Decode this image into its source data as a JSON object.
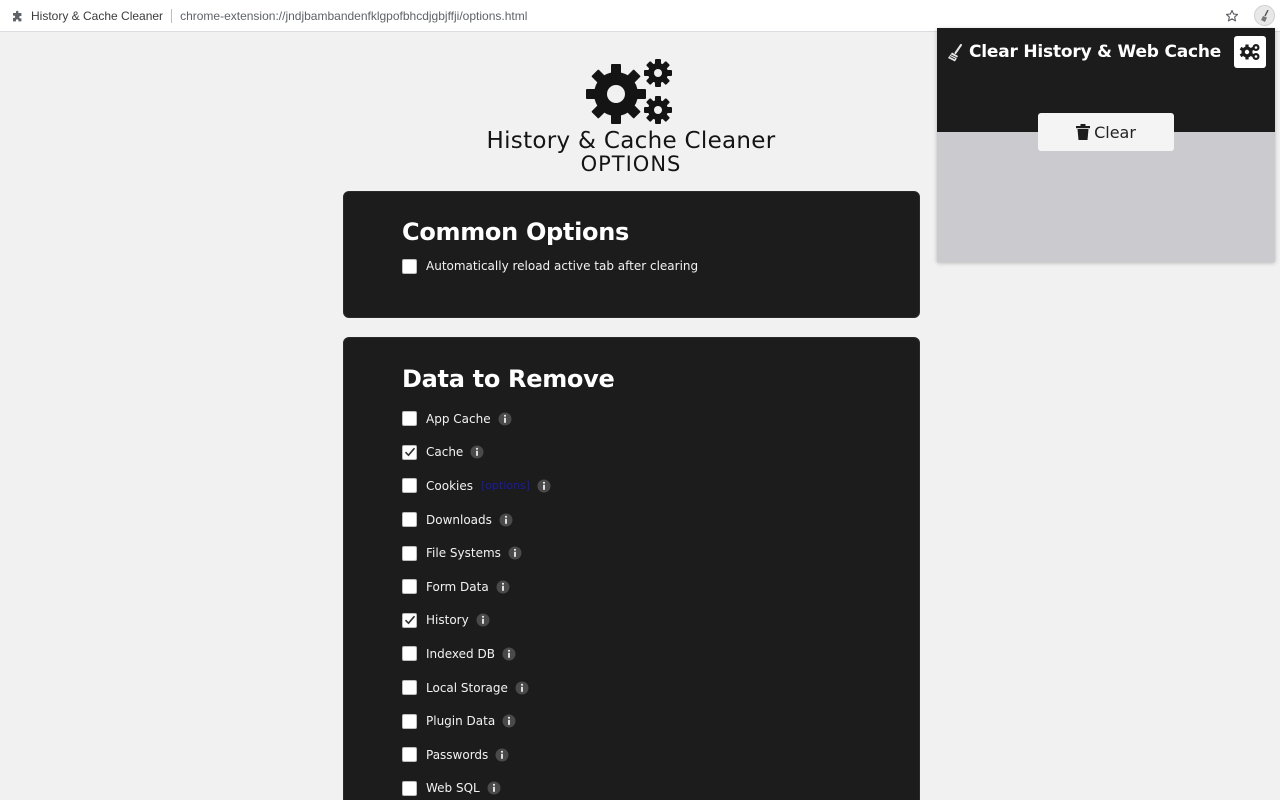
{
  "browser": {
    "tab_title": "History & Cache Cleaner",
    "url": "chrome-extension://jndjbambandenfklgpofbhcdjgbjffji/options.html"
  },
  "header": {
    "title": "History & Cache Cleaner",
    "subtitle": "OPTIONS"
  },
  "common_options": {
    "heading": "Common Options",
    "items": [
      {
        "label": "Automatically reload active tab after clearing",
        "checked": false
      }
    ]
  },
  "data_to_remove": {
    "heading": "Data to Remove",
    "items": [
      {
        "label": "App Cache",
        "checked": false
      },
      {
        "label": "Cache",
        "checked": true
      },
      {
        "label": "Cookies",
        "checked": false,
        "link": "[options]"
      },
      {
        "label": "Downloads",
        "checked": false
      },
      {
        "label": "File Systems",
        "checked": false
      },
      {
        "label": "Form Data",
        "checked": false
      },
      {
        "label": "History",
        "checked": true
      },
      {
        "label": "Indexed DB",
        "checked": false
      },
      {
        "label": "Local Storage",
        "checked": false
      },
      {
        "label": "Plugin Data",
        "checked": false
      },
      {
        "label": "Passwords",
        "checked": false
      },
      {
        "label": "Web SQL",
        "checked": false
      }
    ]
  },
  "popup": {
    "title": "Clear History & Web Cache",
    "clear_label": "Clear"
  },
  "icons": {
    "extension": "puzzle-icon",
    "bookmark": "star-icon",
    "logo": "gears-icon",
    "info": "info-icon",
    "popup_brand": "broom-icon",
    "popup_settings": "gears-icon",
    "clear": "trash-icon"
  },
  "colors": {
    "page_background": "#f1f1f1",
    "card_background": "#1c1c1c",
    "popup_body": "#cbcbcf",
    "link": "#1a1aa6"
  }
}
